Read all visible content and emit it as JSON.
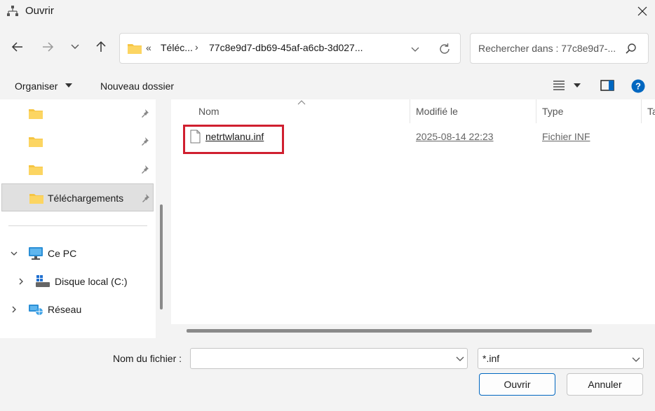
{
  "window": {
    "title": "Ouvrir",
    "close_icon": "close-icon"
  },
  "navigation": {
    "back_icon": "arrow-left-icon",
    "forward_icon": "arrow-right-icon",
    "recent_icon": "chevron-down-icon",
    "up_icon": "arrow-up-icon"
  },
  "address_bar": {
    "overflow": "«",
    "crumbs": [
      "Téléc...",
      "77c8e9d7-db69-45af-a6cb-3d027..."
    ],
    "separator": "›"
  },
  "search": {
    "placeholder": "Rechercher dans : 77c8e9d7-..."
  },
  "toolbar": {
    "organize_label": "Organiser",
    "new_folder_label": "Nouveau dossier"
  },
  "sidebar": {
    "quick_access": [
      {
        "label": "",
        "pinned": true
      },
      {
        "label": "",
        "pinned": true
      },
      {
        "label": "",
        "pinned": true
      },
      {
        "label": "Téléchargements",
        "pinned": true,
        "selected": true
      }
    ],
    "tree": [
      {
        "label": "Ce PC",
        "expanded": true,
        "icon": "monitor-icon"
      },
      {
        "label": "Disque local (C:)",
        "expanded": false,
        "icon": "drive-icon"
      },
      {
        "label": "Réseau",
        "expanded": false,
        "icon": "network-icon"
      }
    ]
  },
  "file_list": {
    "columns": [
      "Nom",
      "Modifié le",
      "Type",
      "Ta"
    ],
    "rows": [
      {
        "name": "netrtwlanu.inf",
        "modified": "2025-08-14 22:23",
        "type": "Fichier INF"
      }
    ]
  },
  "bottom": {
    "filename_label": "Nom du fichier :",
    "filename_value": "",
    "filter_value": "*.inf",
    "open_label": "Ouvrir",
    "cancel_label": "Annuler"
  },
  "colors": {
    "accent": "#0067c0",
    "highlight": "#d01f2f",
    "folder": "#f6c543"
  }
}
